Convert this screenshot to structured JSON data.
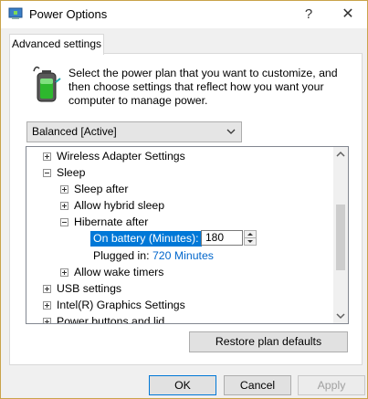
{
  "window": {
    "title": "Power Options",
    "help_glyph": "?",
    "close_glyph": "✕"
  },
  "tab": {
    "label": "Advanced settings"
  },
  "description": "Select the power plan that you want to customize, and then choose settings that reflect how you want your computer to manage power.",
  "plan_select": {
    "value": "Balanced [Active]"
  },
  "tree": {
    "items": [
      {
        "label": "Wireless Adapter Settings",
        "state": "collapsed"
      },
      {
        "label": "Sleep",
        "state": "expanded"
      },
      {
        "label": "Sleep after",
        "state": "collapsed"
      },
      {
        "label": "Allow hybrid sleep",
        "state": "collapsed"
      },
      {
        "label": "Hibernate after",
        "state": "expanded"
      },
      {
        "label": "Allow wake timers",
        "state": "collapsed"
      },
      {
        "label": "USB settings",
        "state": "collapsed"
      },
      {
        "label": "Intel(R) Graphics Settings",
        "state": "collapsed"
      },
      {
        "label": "Power buttons and lid",
        "state": "collapsed"
      }
    ],
    "on_battery": {
      "label": "On battery (Minutes):",
      "value": "180"
    },
    "plugged_in": {
      "label": "Plugged in:",
      "value": "720 Minutes"
    }
  },
  "buttons": {
    "restore": "Restore plan defaults",
    "ok": "OK",
    "cancel": "Cancel",
    "apply": "Apply"
  },
  "colors": {
    "selection": "#0078d7",
    "link_value": "#0066cc",
    "window_border": "#c9a34a"
  }
}
